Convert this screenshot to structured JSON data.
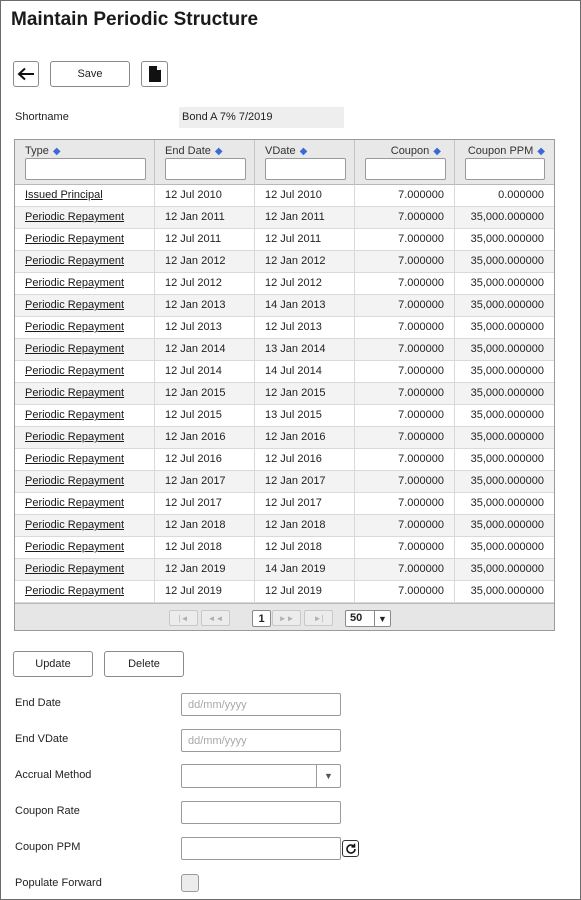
{
  "page": {
    "title": "Maintain Periodic Structure"
  },
  "toolbar": {
    "back_icon": "arrow-left-icon",
    "save_label": "Save",
    "doc_icon": "document-icon"
  },
  "shortname": {
    "label": "Shortname",
    "value": "Bond A 7% 7/2019"
  },
  "grid": {
    "columns": [
      "Type",
      "End Date",
      "VDate",
      "Coupon",
      "Coupon PPM"
    ],
    "rows": [
      [
        "Issued Principal",
        "12 Jul 2010",
        "12 Jul 2010",
        "7.000000",
        "0.000000"
      ],
      [
        "Periodic Repayment",
        "12 Jan 2011",
        "12 Jan 2011",
        "7.000000",
        "35,000.000000"
      ],
      [
        "Periodic Repayment",
        "12 Jul 2011",
        "12 Jul 2011",
        "7.000000",
        "35,000.000000"
      ],
      [
        "Periodic Repayment",
        "12 Jan 2012",
        "12 Jan 2012",
        "7.000000",
        "35,000.000000"
      ],
      [
        "Periodic Repayment",
        "12 Jul 2012",
        "12 Jul 2012",
        "7.000000",
        "35,000.000000"
      ],
      [
        "Periodic Repayment",
        "12 Jan 2013",
        "14 Jan 2013",
        "7.000000",
        "35,000.000000"
      ],
      [
        "Periodic Repayment",
        "12 Jul 2013",
        "12 Jul 2013",
        "7.000000",
        "35,000.000000"
      ],
      [
        "Periodic Repayment",
        "12 Jan 2014",
        "13 Jan 2014",
        "7.000000",
        "35,000.000000"
      ],
      [
        "Periodic Repayment",
        "12 Jul 2014",
        "14 Jul 2014",
        "7.000000",
        "35,000.000000"
      ],
      [
        "Periodic Repayment",
        "12 Jan 2015",
        "12 Jan 2015",
        "7.000000",
        "35,000.000000"
      ],
      [
        "Periodic Repayment",
        "12 Jul 2015",
        "13 Jul 2015",
        "7.000000",
        "35,000.000000"
      ],
      [
        "Periodic Repayment",
        "12 Jan 2016",
        "12 Jan 2016",
        "7.000000",
        "35,000.000000"
      ],
      [
        "Periodic Repayment",
        "12 Jul 2016",
        "12 Jul 2016",
        "7.000000",
        "35,000.000000"
      ],
      [
        "Periodic Repayment",
        "12 Jan 2017",
        "12 Jan 2017",
        "7.000000",
        "35,000.000000"
      ],
      [
        "Periodic Repayment",
        "12 Jul 2017",
        "12 Jul 2017",
        "7.000000",
        "35,000.000000"
      ],
      [
        "Periodic Repayment",
        "12 Jan 2018",
        "12 Jan 2018",
        "7.000000",
        "35,000.000000"
      ],
      [
        "Periodic Repayment",
        "12 Jul 2018",
        "12 Jul 2018",
        "7.000000",
        "35,000.000000"
      ],
      [
        "Periodic Repayment",
        "12 Jan 2019",
        "14 Jan 2019",
        "7.000000",
        "35,000.000000"
      ],
      [
        "Periodic Repayment",
        "12 Jul 2019",
        "12 Jul 2019",
        "7.000000",
        "35,000.000000"
      ]
    ],
    "pager": {
      "first": "|◄",
      "prev": "◄◄",
      "page": "1",
      "next": "►►",
      "last": "►|",
      "page_size": "50"
    }
  },
  "actions": {
    "update_label": "Update",
    "delete_label": "Delete"
  },
  "form": {
    "end_date": {
      "label": "End Date",
      "placeholder": "dd/mm/yyyy"
    },
    "end_vdate": {
      "label": "End VDate",
      "placeholder": "dd/mm/yyyy"
    },
    "accrual_method": {
      "label": "Accrual Method"
    },
    "coupon_rate": {
      "label": "Coupon Rate"
    },
    "coupon_ppm": {
      "label": "Coupon PPM"
    },
    "populate_forward": {
      "label": "Populate Forward"
    }
  }
}
